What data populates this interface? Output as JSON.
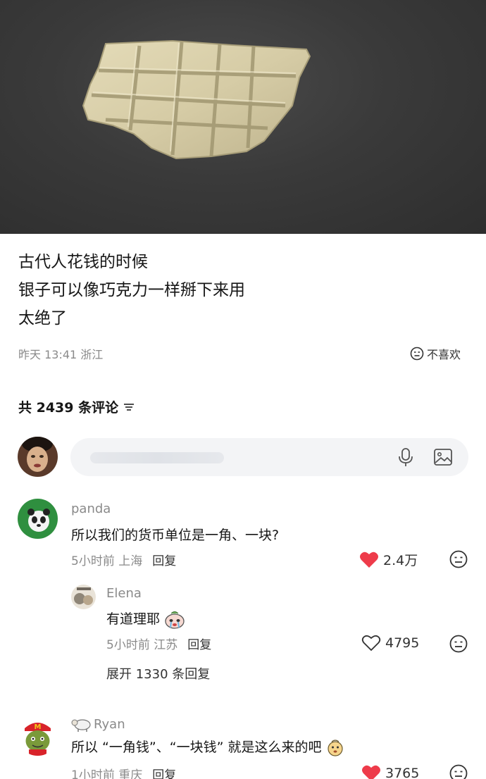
{
  "post": {
    "caption_lines": [
      "古代人花钱的时候",
      "银子可以像巧克力一样掰下来用",
      "太绝了"
    ],
    "time": "昨天 13:41 浙江",
    "dislike_label": "不喜欢"
  },
  "comments_header": {
    "count_label": "共 2439 条评论"
  },
  "comments": [
    {
      "user": "panda",
      "text": "所以我们的货币单位是一角、一块?",
      "time_loc": "5小时前 上海",
      "reply_label": "回复",
      "likes": "2.4万",
      "liked": true,
      "reply": {
        "user": "Elena",
        "text": "有道理耶",
        "time_loc": "5小时前 江苏",
        "reply_label": "回复",
        "likes": "4795"
      },
      "expand_label": "展开 1330 条回复"
    },
    {
      "user": "Ryan",
      "text": "所以 “一角钱”、“一块钱” 就是这么来的吧",
      "time_loc": "1小时前 重庆",
      "reply_label": "回复",
      "likes": "3765",
      "liked": true
    }
  ],
  "colors": {
    "like_red": "#ee3b4a",
    "muted": "#8a8a8a",
    "input_bg": "#f3f4f6"
  }
}
